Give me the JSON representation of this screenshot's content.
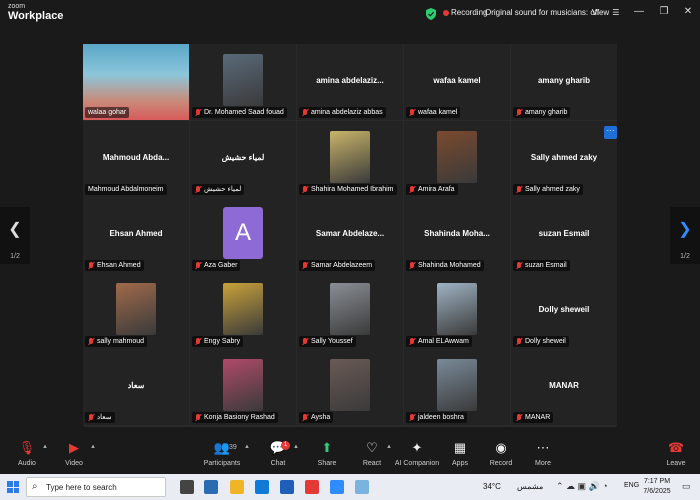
{
  "app": {
    "brand_line1": "zoom",
    "brand_line2": "Workplace"
  },
  "topbar": {
    "recording": "Recording",
    "original_sound": "Original sound for musicians: off",
    "view": "View"
  },
  "tiles": [
    {
      "kind": "video",
      "label": "walaa gohar",
      "active": true
    },
    {
      "kind": "photo",
      "label": "Dr. Mohamed Saad fouad",
      "muted": true,
      "photo_color": "#5a6a7a"
    },
    {
      "kind": "name",
      "display": "amina  abdelaziz...",
      "label": "amina abdelaziz abbas",
      "muted": true
    },
    {
      "kind": "name",
      "display": "wafaa kamel",
      "label": "wafaa kamel",
      "muted": true
    },
    {
      "kind": "name",
      "display": "amany gharib",
      "label": "amany gharib",
      "muted": true
    },
    {
      "kind": "name",
      "display": "Mahmoud  Abda...",
      "label": "Mahmoud Abdalmoneim",
      "muted": false
    },
    {
      "kind": "name",
      "display": "لمياء حشيش",
      "label": "لمياء حشيش",
      "muted": true
    },
    {
      "kind": "photo",
      "label": "Shahira Mohamed Ibrahim",
      "muted": true,
      "photo_color": "#c9b46a"
    },
    {
      "kind": "photo",
      "label": "Amira Arafa",
      "muted": true,
      "photo_color": "#7a4a2e"
    },
    {
      "kind": "name",
      "display": "Sally ahmed zaky",
      "label": "Sally ahmed zaky",
      "muted": true
    },
    {
      "kind": "name",
      "display": "Ehsan Ahmed",
      "label": "Ehsan Ahmed",
      "muted": true
    },
    {
      "kind": "avatar",
      "letter": "A",
      "label": "Aza Gaber",
      "muted": true
    },
    {
      "kind": "name",
      "display": "Samar  Abdelaze...",
      "label": "Samar Abdelazeem",
      "muted": true
    },
    {
      "kind": "name",
      "display": "Shahinda  Moha...",
      "label": "Shahinda Mohamed",
      "muted": true
    },
    {
      "kind": "name",
      "display": "suzan Esmail",
      "label": "suzan Esmail",
      "muted": true
    },
    {
      "kind": "photo",
      "label": "sally mahmoud",
      "muted": true,
      "photo_color": "#a06a4a"
    },
    {
      "kind": "photo",
      "label": "Engy Sabry",
      "muted": true,
      "photo_color": "#c9a23a"
    },
    {
      "kind": "photo",
      "label": "Sally Youssef",
      "muted": true,
      "photo_color": "#8a8f95"
    },
    {
      "kind": "photo",
      "label": "Amal ELAwwam",
      "muted": true,
      "photo_color": "#9fb3c4"
    },
    {
      "kind": "name",
      "display": "Dolly sheweil",
      "label": "Dolly sheweil",
      "muted": true
    },
    {
      "kind": "name",
      "display": "سعاد",
      "label": "سعاد",
      "muted": true
    },
    {
      "kind": "photo",
      "label": "Konja Basiony Rashad",
      "muted": true,
      "photo_color": "#b04a6a"
    },
    {
      "kind": "photo",
      "label": "Aysha",
      "muted": true,
      "photo_color": "#6a5a55"
    },
    {
      "kind": "photo",
      "label": "jaldeen boshra",
      "muted": true,
      "photo_color": "#7a8a99"
    },
    {
      "kind": "name",
      "display": "MANAR",
      "label": "MANAR",
      "muted": true
    }
  ],
  "pager": {
    "left": "1/2",
    "right": "1/2"
  },
  "toolbar": {
    "audio": "Audio",
    "video": "Video",
    "participants": "Participants",
    "participants_count": "39",
    "chat": "Chat",
    "chat_badge": "1",
    "share": "Share",
    "react": "React",
    "ai_companion": "AI Companion",
    "apps": "Apps",
    "record": "Record",
    "more": "More",
    "leave": "Leave"
  },
  "taskbar": {
    "search_placeholder": "Type here to search",
    "temperature": "34°C",
    "city": "مشمس",
    "lang": "ENG",
    "time": "7:17 PM",
    "date": "7/6/2025"
  },
  "colors": {
    "accent_green": "#2ecc71",
    "zoom_blue": "#2d8cff",
    "muted_red": "#e53935"
  }
}
